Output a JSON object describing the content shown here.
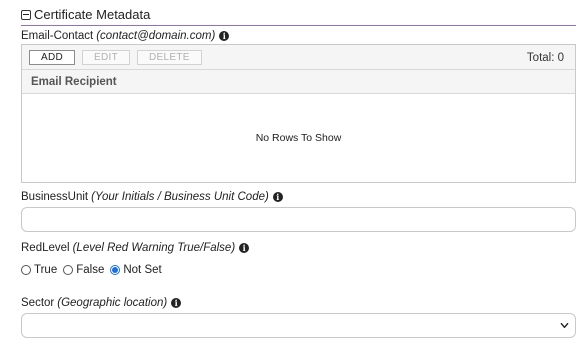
{
  "section": {
    "title": "Certificate Metadata"
  },
  "email_contact": {
    "label": "Email-Contact",
    "hint": "(contact@domain.com)",
    "toolbar": {
      "add": "ADD",
      "edit": "EDIT",
      "delete": "DELETE"
    },
    "total": "Total: 0",
    "column_header": "Email Recipient",
    "empty_text": "No Rows To Show"
  },
  "business_unit": {
    "label": "BusinessUnit",
    "hint": "(Your Initials / Business Unit Code)",
    "value": ""
  },
  "red_level": {
    "label": "RedLevel",
    "hint": "(Level Red Warning True/False)",
    "options": [
      "True",
      "False",
      "Not Set"
    ],
    "selected": "Not Set"
  },
  "sector": {
    "label": "Sector",
    "hint": "(Geographic location)",
    "selected": ""
  },
  "colors": {
    "accent": "#8a72c8",
    "radio_checked": "#1a6fe0"
  }
}
